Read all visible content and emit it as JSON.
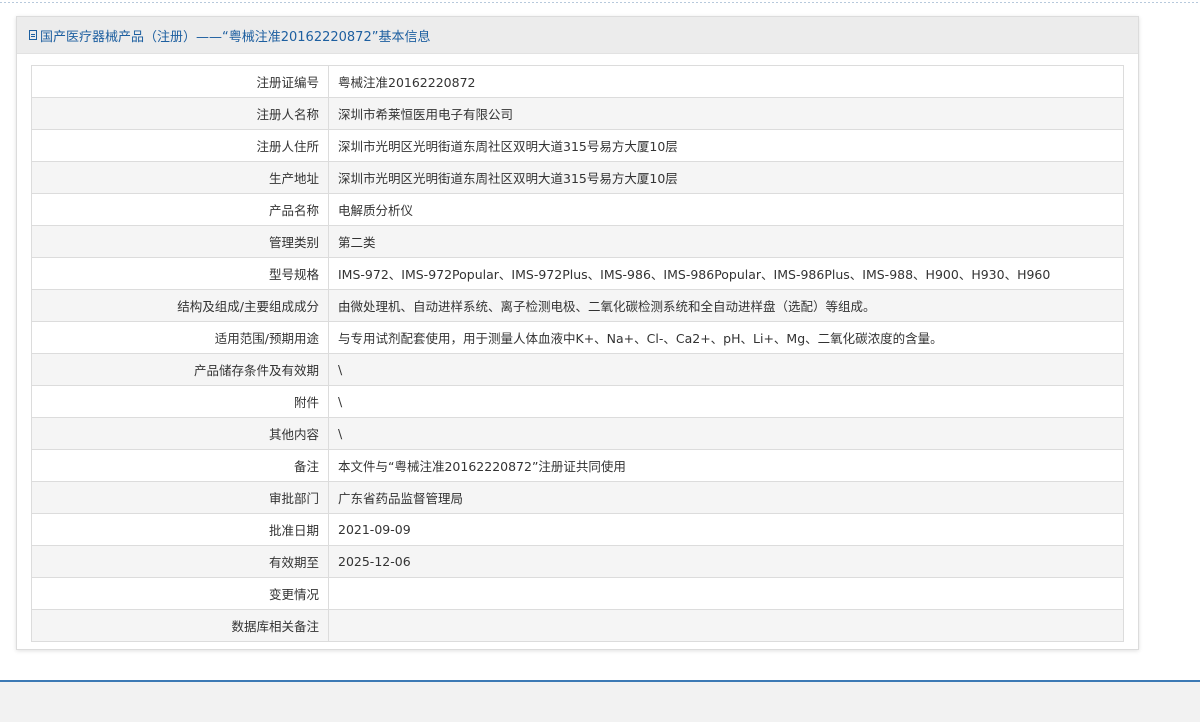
{
  "header": {
    "title": "国产医疗器械产品（注册）——“粤械注准20162220872”基本信息"
  },
  "rows": [
    {
      "label": "注册证编号",
      "value": "粤械注准20162220872"
    },
    {
      "label": "注册人名称",
      "value": "深圳市希莱恒医用电子有限公司"
    },
    {
      "label": "注册人住所",
      "value": "深圳市光明区光明街道东周社区双明大道315号易方大厦10层"
    },
    {
      "label": "生产地址",
      "value": "深圳市光明区光明街道东周社区双明大道315号易方大厦10层"
    },
    {
      "label": "产品名称",
      "value": "电解质分析仪"
    },
    {
      "label": "管理类别",
      "value": "第二类"
    },
    {
      "label": "型号规格",
      "value": "IMS-972、IMS-972Popular、IMS-972Plus、IMS-986、IMS-986Popular、IMS-986Plus、IMS-988、H900、H930、H960"
    },
    {
      "label": "结构及组成/主要组成成分",
      "value": "由微处理机、自动进样系统、离子检测电极、二氧化碳检测系统和全自动进样盘（选配）等组成。"
    },
    {
      "label": "适用范围/预期用途",
      "value": "与专用试剂配套使用，用于测量人体血液中K+、Na+、Cl-、Ca2+、pH、Li+、Mg、二氧化碳浓度的含量。"
    },
    {
      "label": "产品储存条件及有效期",
      "value": "\\"
    },
    {
      "label": "附件",
      "value": "\\"
    },
    {
      "label": "其他内容",
      "value": "\\"
    },
    {
      "label": "备注",
      "value": "本文件与“粤械注准20162220872”注册证共同使用"
    },
    {
      "label": "审批部门",
      "value": "广东省药品监督管理局"
    },
    {
      "label": "批准日期",
      "value": "2021-09-09"
    },
    {
      "label": "有效期至",
      "value": "2025-12-06"
    },
    {
      "label": "变更情况",
      "value": ""
    },
    {
      "label": "数据库相关备注",
      "value": ""
    }
  ]
}
